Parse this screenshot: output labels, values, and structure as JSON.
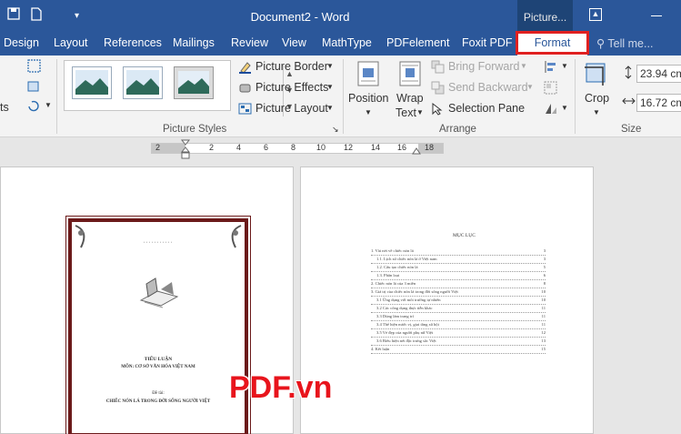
{
  "window": {
    "title": "Document2 - Word",
    "context_tab": "Picture...",
    "colors": {
      "titlebar": "#2b579a",
      "highlight": "#e02020",
      "frame": "#6b1a1a",
      "watermark": "#e8141c"
    }
  },
  "quick_access": [
    "save-icon",
    "new-document-icon",
    "customize-qat-icon"
  ],
  "tabs": [
    "Design",
    "Layout",
    "References",
    "Mailings",
    "Review",
    "View",
    "MathType",
    "PDFelement",
    "Foxit PDF",
    "Format"
  ],
  "tell_me": "Tell me...",
  "ribbon": {
    "left_cut_label": "ts",
    "picture_styles": {
      "label": "Picture Styles",
      "commands": [
        "Picture Border",
        "Picture Effects",
        "Picture Layout"
      ]
    },
    "arrange": {
      "label": "Arrange",
      "position": [
        "Position"
      ],
      "wrap_text": [
        "Wrap",
        "Text"
      ],
      "commands": [
        "Bring Forward",
        "Send Backward",
        "Selection Pane"
      ]
    },
    "size": {
      "label": "Size",
      "crop": "Crop",
      "height": "23.94 cm",
      "width": "16.72 cm"
    }
  },
  "ruler": {
    "numbers": [
      "2",
      "2",
      "4",
      "6",
      "8",
      "10",
      "12",
      "14",
      "16",
      "18"
    ]
  },
  "cover_page": {
    "top_line": "···········",
    "heading": "TIỂU LUẬN",
    "subject": "MÔN: CƠ SỞ VĂN HÓA VIỆT NAM",
    "topic_label": "Đề tài:",
    "topic": "CHIẾC NÓN LÁ TRONG ĐỜI SỐNG NGƯỜI VIỆT"
  },
  "toc_page": {
    "title": "MỤC LỤC",
    "entries": [
      {
        "label": "1. Vài nét về chiếc nón lá",
        "page": "3"
      },
      {
        "label": "1.1. Lịch sử chiếc nón lá ở Việt nam",
        "page": "3"
      },
      {
        "label": "1.2. Cấu tạo chiếc nón lá",
        "page": "5"
      },
      {
        "label": "1.3. Phân loại",
        "page": "6"
      },
      {
        "label": "2. Chiếc nón lá của 3 miền",
        "page": "8"
      },
      {
        "label": "3. Giá trị của chiếc nón lá trong đời sống người Việt",
        "page": "10"
      },
      {
        "label": "3.1 Ứng dụng với môi trường tự nhiên",
        "page": "10"
      },
      {
        "label": "3.2 Các công dụng thực tiễn khác",
        "page": "11"
      },
      {
        "label": "3.3 Dùng làm trang trí",
        "page": "11"
      },
      {
        "label": "3.4 Thể hiện nước vị, giai tầng xã hội",
        "page": "11"
      },
      {
        "label": "3.5 Vẻ đẹp của người phụ nữ Việt",
        "page": "12"
      },
      {
        "label": "3.6 Biểu hiện nét đặc trưng sắc Việt",
        "page": "13"
      },
      {
        "label": "4. Kết luận",
        "page": "15"
      }
    ]
  },
  "watermark": "PDF.vn"
}
